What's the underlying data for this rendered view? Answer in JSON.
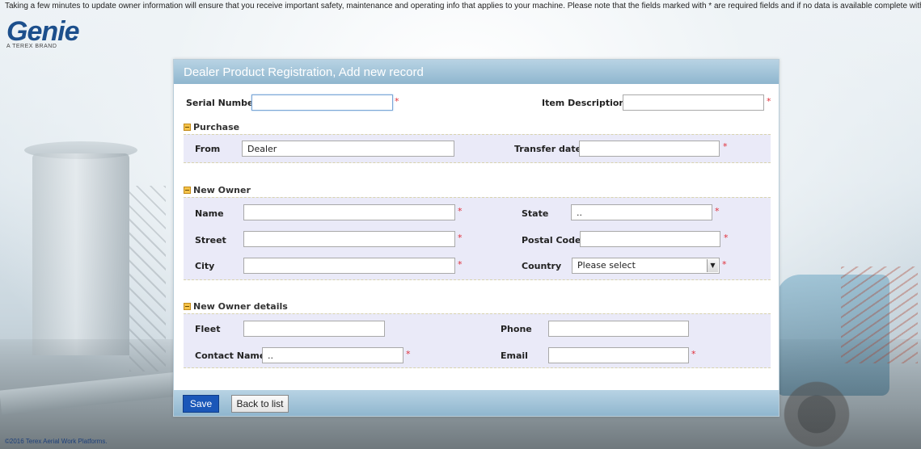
{
  "top_note": "Taking a few minutes to update owner information will ensure that you receive important safety, maintenance and operating info that applies to your machine. Please note that the fields marked with * are required fields and if no data is available complete with ..(dotdot).",
  "logo": {
    "word": "Genie",
    "sub": "A TEREX BRAND"
  },
  "panel": {
    "title": "Dealer Product Registration, Add new record"
  },
  "required_mark": "*",
  "fields": {
    "serial_number": {
      "label": "Serial Number",
      "value": ""
    },
    "item_description": {
      "label": "Item Description",
      "value": ""
    }
  },
  "purchase": {
    "title": "Purchase",
    "from": {
      "label": "From",
      "value": "Dealer"
    },
    "transfer_date": {
      "label": "Transfer date",
      "value": ""
    }
  },
  "new_owner": {
    "title": "New Owner",
    "name": {
      "label": "Name",
      "value": ""
    },
    "street": {
      "label": "Street",
      "value": ""
    },
    "city": {
      "label": "City",
      "value": ""
    },
    "state": {
      "label": "State",
      "value": ".."
    },
    "postal_code": {
      "label": "Postal Code",
      "value": ""
    },
    "country": {
      "label": "Country",
      "value": "Please select"
    }
  },
  "new_owner_details": {
    "title": "New Owner details",
    "fleet": {
      "label": "Fleet",
      "value": ""
    },
    "contact_name": {
      "label": "Contact Name",
      "value": ".."
    },
    "phone": {
      "label": "Phone",
      "value": ""
    },
    "email": {
      "label": "Email",
      "value": ""
    }
  },
  "buttons": {
    "save": "Save",
    "back": "Back to list"
  },
  "copyright": "©2016 Terex Aerial Work Platforms.",
  "colors": {
    "brand": "#1c4f8c",
    "header": "#8fb6ce",
    "save_button": "#1a57b8",
    "required": "#e0303a",
    "section_bg": "#eaeaf8"
  }
}
